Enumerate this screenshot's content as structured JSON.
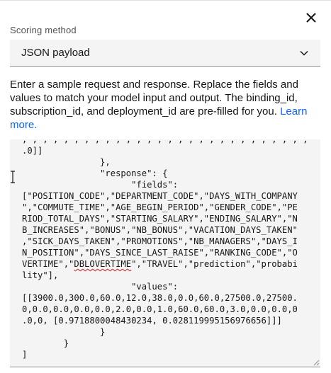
{
  "panel": {
    "close_icon": "close-icon",
    "scoring_label": "Scoring method",
    "scoring_value": "JSON payload",
    "dropdown_icon": "chevron-down-icon",
    "help_text": "Enter a sample request and response. Replace the fields and values to match your model input and output. The binding_id, subscription_id, and deployment_id are pre-filled for you.",
    "learn_more": "Learn more."
  },
  "editor": {
    "lines": [
      ", , , , , , , , , , , , , , , , , , , , , , , , , , , ,",
      ".0]]",
      "               },",
      "               \"response\": {",
      "                     \"fields\":",
      "[\"POSITION_CODE\",\"DEPARTMENT_CODE\",\"DAYS_WITH_COMPANY",
      "\",\"COMMUTE_TIME\",\"AGE_BEGIN_PERIOD\",\"GENDER_CODE\",\"PE",
      "RIOD_TOTAL_DAYS\",\"STARTING_SALARY\",\"ENDING_SALARY\",\"N",
      "B_INCREASES\",\"BONUS\",\"NB_BONUS\",\"VACATION_DAYS_TAKEN\"",
      ",\"SICK_DAYS_TAKEN\",\"PROMOTIONS\",\"NB_MANAGERS\",\"DAYS_I",
      "N_POSITION\",\"DAYS_SINCE_LAST_RAISE\",\"RANKING_CODE\",\"O",
      "VERTIME\",\"",
      "\",\"TRAVEL\",\"prediction\",\"probabi",
      "lity\"],",
      "                     \"values\":",
      "[[3900.0,300.0,60.0,12.0,38.0,0.0,60.0,27500.0,27500.",
      "0,0.0,0.0,0.0,0.0,2.0,0.0,1.0,60.0,60.0,3.0,0.0,0.0,0",
      ".0,0, [0.9718800048430234, 0.028119995156976656]]]",
      "               }",
      "        }",
      "]"
    ],
    "misspelled_word": "DBLOVERTIME"
  }
}
